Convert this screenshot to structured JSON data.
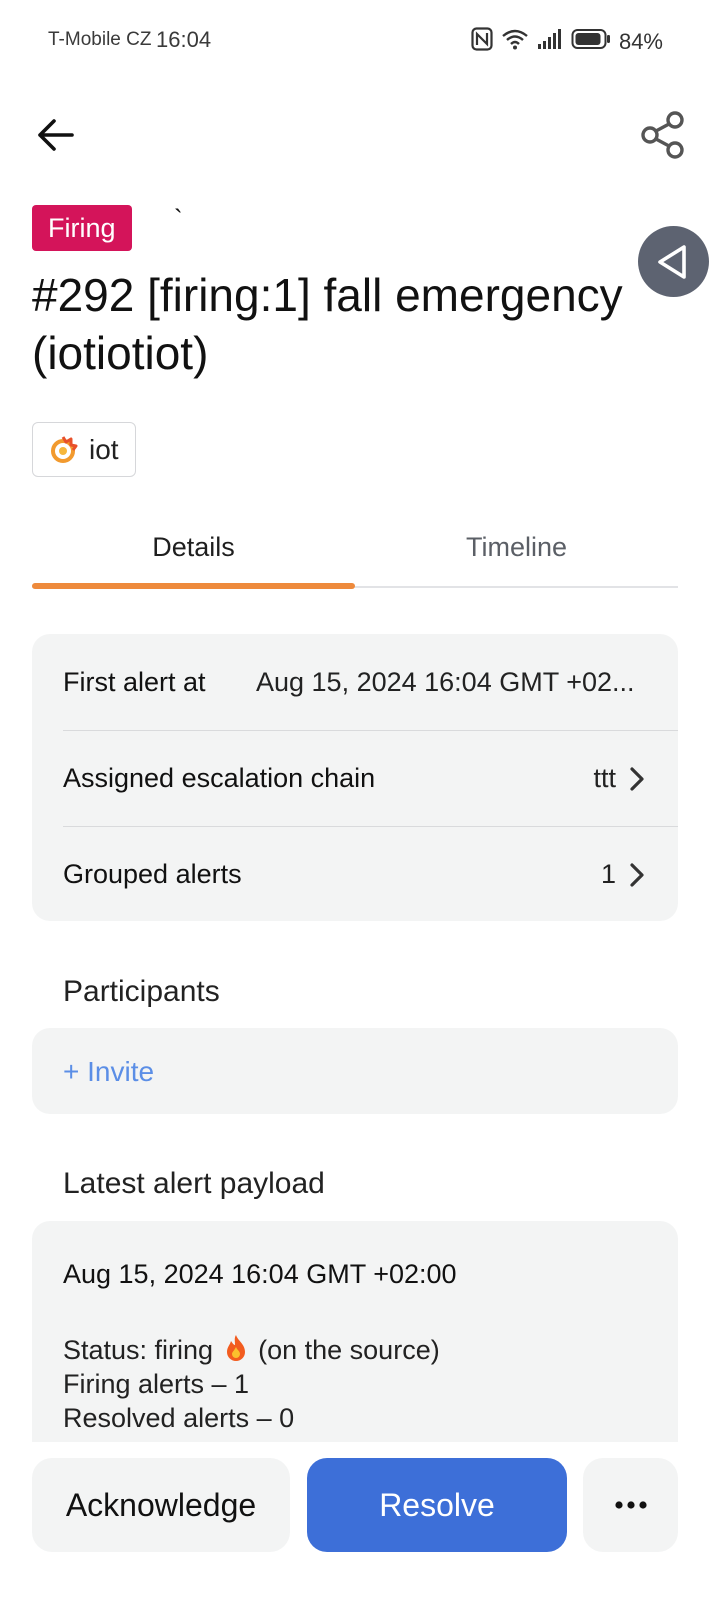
{
  "status_bar": {
    "carrier": "T-Mobile CZ",
    "time": "16:04",
    "battery_pct": "84%"
  },
  "header": {
    "back_icon": "arrow-left-icon",
    "share_icon": "share-icon"
  },
  "alert": {
    "status_badge": "Firing",
    "stray_mark": "`",
    "title": "#292 [firing:1] fall emergency (iotiotiot)",
    "source_chip": "iot",
    "source_icon": "grafana-icon"
  },
  "tabs": [
    {
      "label": "Details",
      "active": true
    },
    {
      "label": "Timeline",
      "active": false
    }
  ],
  "details": {
    "first_alert_label": "First alert at",
    "first_alert_value": "Aug 15, 2024 16:04 GMT +02...",
    "escalation_label": "Assigned escalation chain",
    "escalation_value": "ttt",
    "grouped_label": "Grouped alerts",
    "grouped_value": "1"
  },
  "participants": {
    "title": "Participants",
    "invite_label": "+ Invite"
  },
  "payload": {
    "title": "Latest alert payload",
    "timestamp": "Aug 15, 2024 16:04 GMT +02:00",
    "status_prefix": "Status: firing",
    "status_suffix": "(on the source)",
    "firing_line": "Firing alerts – 1",
    "resolved_line": "Resolved alerts – 0"
  },
  "actions": {
    "acknowledge": "Acknowledge",
    "resolve": "Resolve",
    "more": "•••"
  },
  "colors": {
    "firing_badge": "#d4145a",
    "tab_indicator": "#ee8a3c",
    "primary": "#3d6fd8",
    "link": "#5b8ee6",
    "card_bg": "#f3f4f4"
  }
}
